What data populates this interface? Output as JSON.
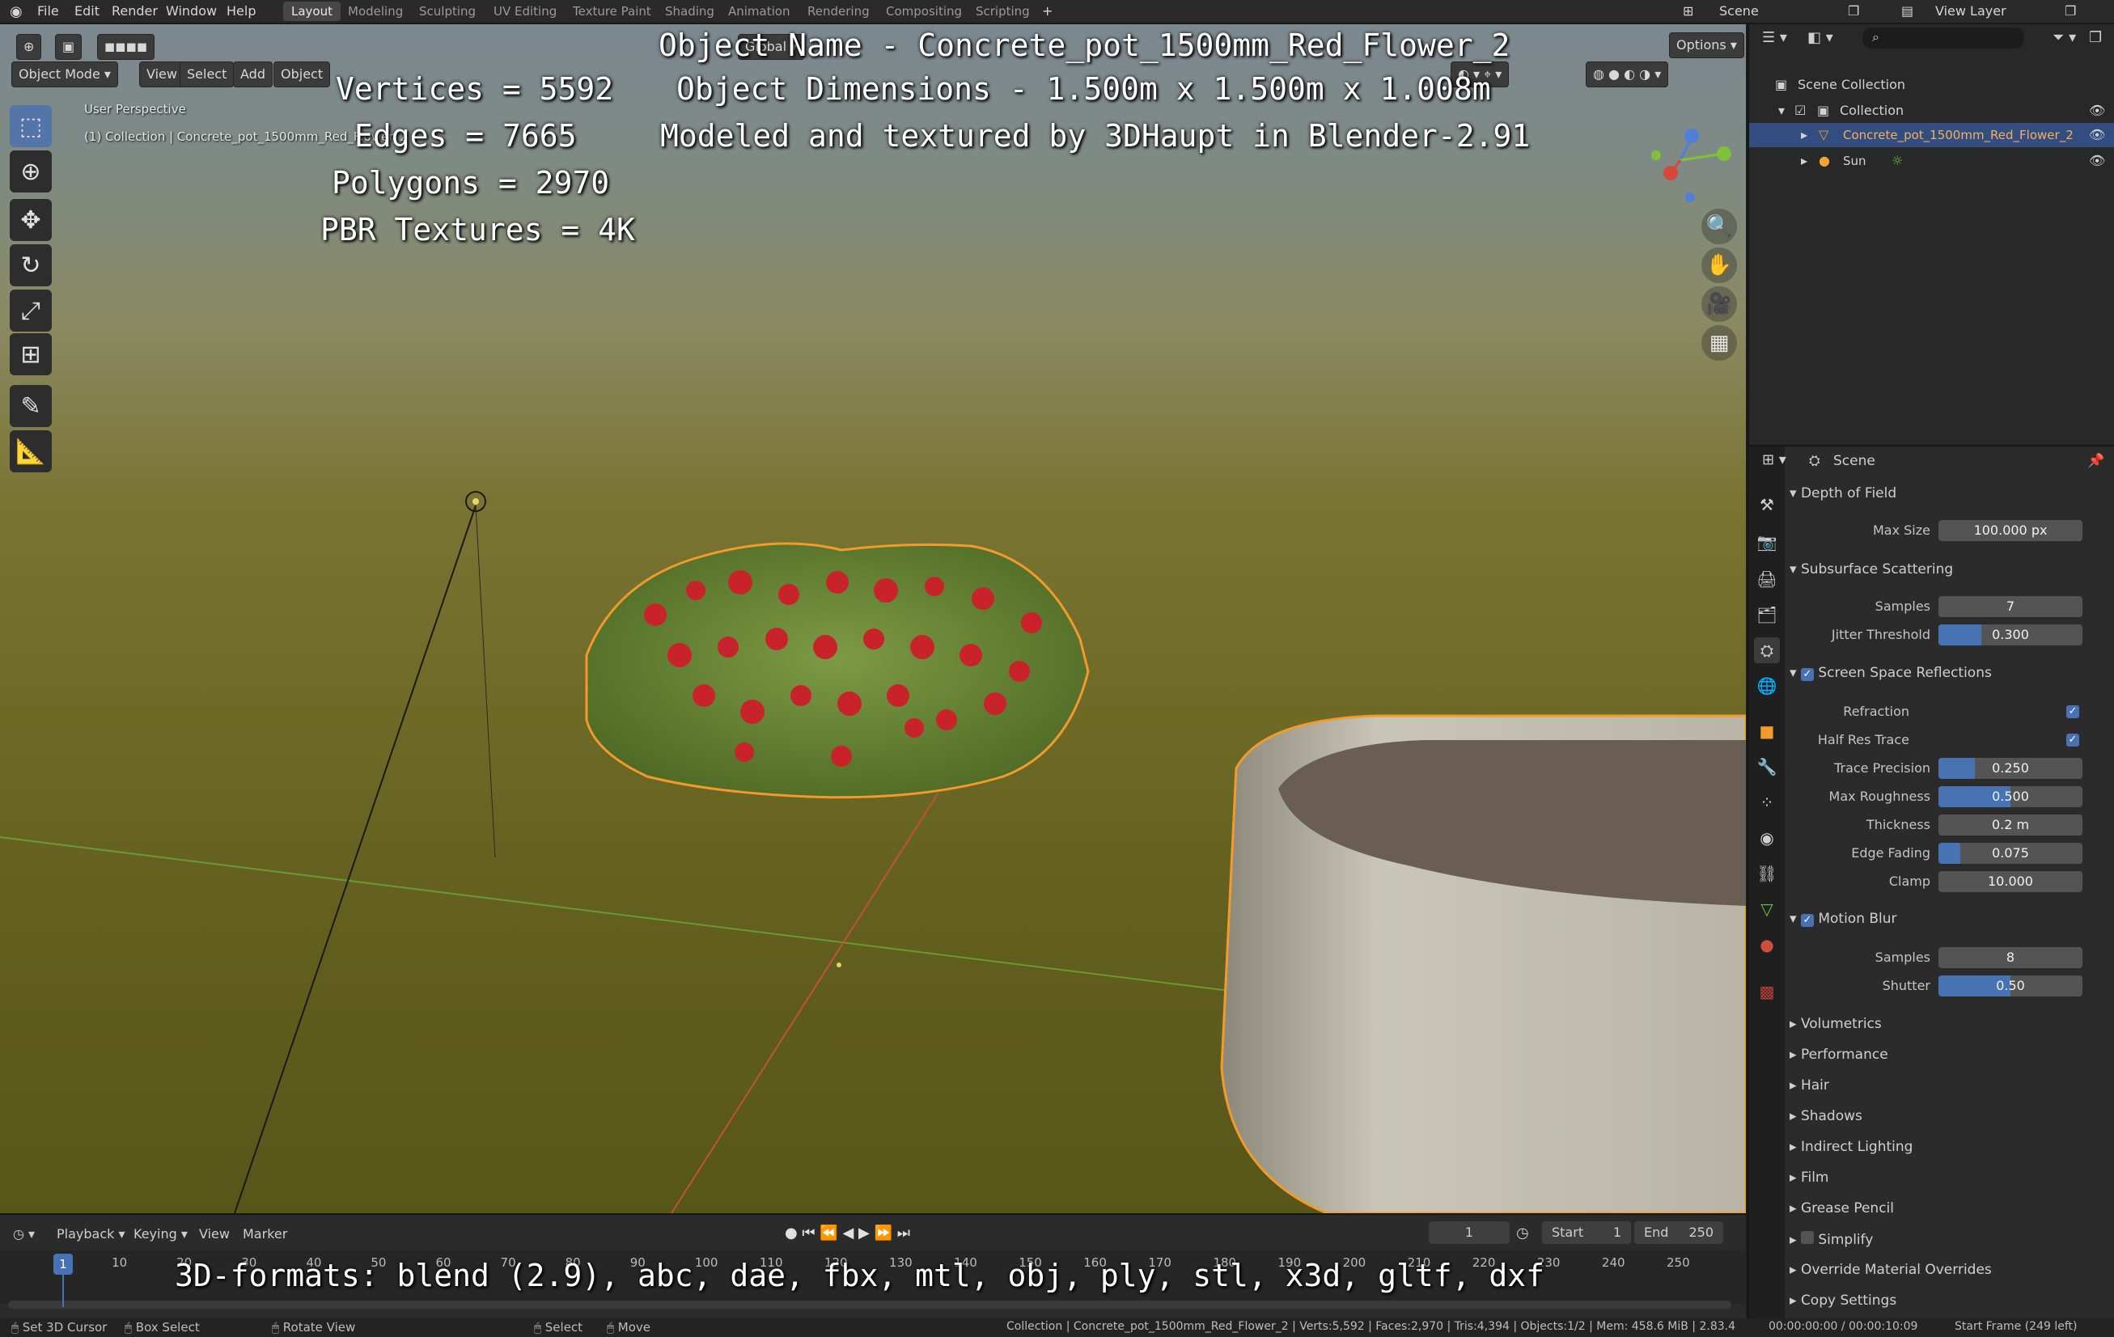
{
  "topbar": {
    "menus": [
      "File",
      "Edit",
      "Render",
      "Window",
      "Help"
    ],
    "workspaces": [
      "Layout",
      "Modeling",
      "Sculpting",
      "UV Editing",
      "Texture Paint",
      "Shading",
      "Animation",
      "Rendering",
      "Compositing",
      "Scripting"
    ],
    "active_workspace": "Layout",
    "scene_label": "Scene",
    "view_layer_label": "View Layer"
  },
  "viewport_header": {
    "mode": "Object Mode",
    "menus": [
      "View",
      "Select",
      "Add",
      "Object"
    ],
    "transform_orientation": "Global",
    "options_label": "Options"
  },
  "viewport": {
    "perspective_label": "User Perspective",
    "collection_label": "(1) Collection | Concrete_pot_1500mm_Red_Flower_2"
  },
  "overlay": {
    "vertices": "Vertices = 5592",
    "edges": "Edges = 7665",
    "polygons": "Polygons = 2970",
    "textures": "PBR Textures = 4K",
    "object_name": "Object Name - Concrete_pot_1500mm_Red_Flower_2",
    "dimensions": "Object Dimensions -  1.500m x 1.500m x 1.008m",
    "credit": "Modeled and textured by 3DHaupt in Blender-2.91",
    "formats": "3D-formats: blend (2.9), abc, dae, fbx, mtl, obj, ply, stl, x3d, gltf, dxf"
  },
  "outliner": {
    "root": "Scene Collection",
    "collection": "Collection",
    "items": [
      {
        "label": "Concrete_pot_1500mm_Red_Flower_2",
        "selected": true
      },
      {
        "label": "Sun",
        "selected": false
      }
    ]
  },
  "properties": {
    "context": "Scene",
    "dof": {
      "header": "Depth of Field",
      "max_size_label": "Max Size",
      "max_size": "100.000 px"
    },
    "sss": {
      "header": "Subsurface Scattering",
      "samples_label": "Samples",
      "samples": "7",
      "jitter_label": "Jitter Threshold",
      "jitter": "0.300",
      "jitter_fill": 0.3
    },
    "ssr": {
      "header": "Screen Space Reflections",
      "refraction_label": "Refraction",
      "half_res_label": "Half Res Trace",
      "trace_precision_label": "Trace Precision",
      "trace_precision": "0.250",
      "trace_precision_fill": 0.25,
      "max_roughness_label": "Max Roughness",
      "max_roughness": "0.500",
      "max_roughness_fill": 0.5,
      "thickness_label": "Thickness",
      "thickness": "0.2 m",
      "edge_fading_label": "Edge Fading",
      "edge_fading": "0.075",
      "edge_fading_fill": 0.15,
      "clamp_label": "Clamp",
      "clamp": "10.000"
    },
    "motion_blur": {
      "header": "Motion Blur",
      "samples_label": "Samples",
      "samples": "8",
      "shutter_label": "Shutter",
      "shutter": "0.50",
      "shutter_fill": 0.5
    },
    "collapsed": [
      "Volumetrics",
      "Performance",
      "Hair",
      "Shadows",
      "Indirect Lighting",
      "Film",
      "Grease Pencil",
      "Simplify",
      "Override Material Overrides",
      "Copy Settings"
    ]
  },
  "timeline": {
    "menus": [
      "Playback",
      "Keying",
      "View",
      "Marker"
    ],
    "current_frame": "1",
    "start_label": "Start",
    "start": "1",
    "end_label": "End",
    "end": "250",
    "ticks": [
      "1",
      "10",
      "20",
      "30",
      "40",
      "50",
      "60",
      "70",
      "80",
      "90",
      "100",
      "110",
      "120",
      "130",
      "140",
      "150",
      "160",
      "170",
      "180",
      "190",
      "200",
      "210",
      "220",
      "230",
      "240",
      "250"
    ]
  },
  "statusbar": {
    "left": [
      "Set 3D Cursor",
      "Box Select",
      "Rotate View",
      "Select",
      "Move"
    ],
    "info": "Collection | Concrete_pot_1500mm_Red_Flower_2 | Verts:5,592 | Faces:2,970 | Tris:4,394 | Objects:1/2 | Mem: 458.6 MiB | 2.83.4",
    "time": "00:00:00:00 / 00:00:10:09",
    "start_frame": "Start Frame (249 left)"
  }
}
